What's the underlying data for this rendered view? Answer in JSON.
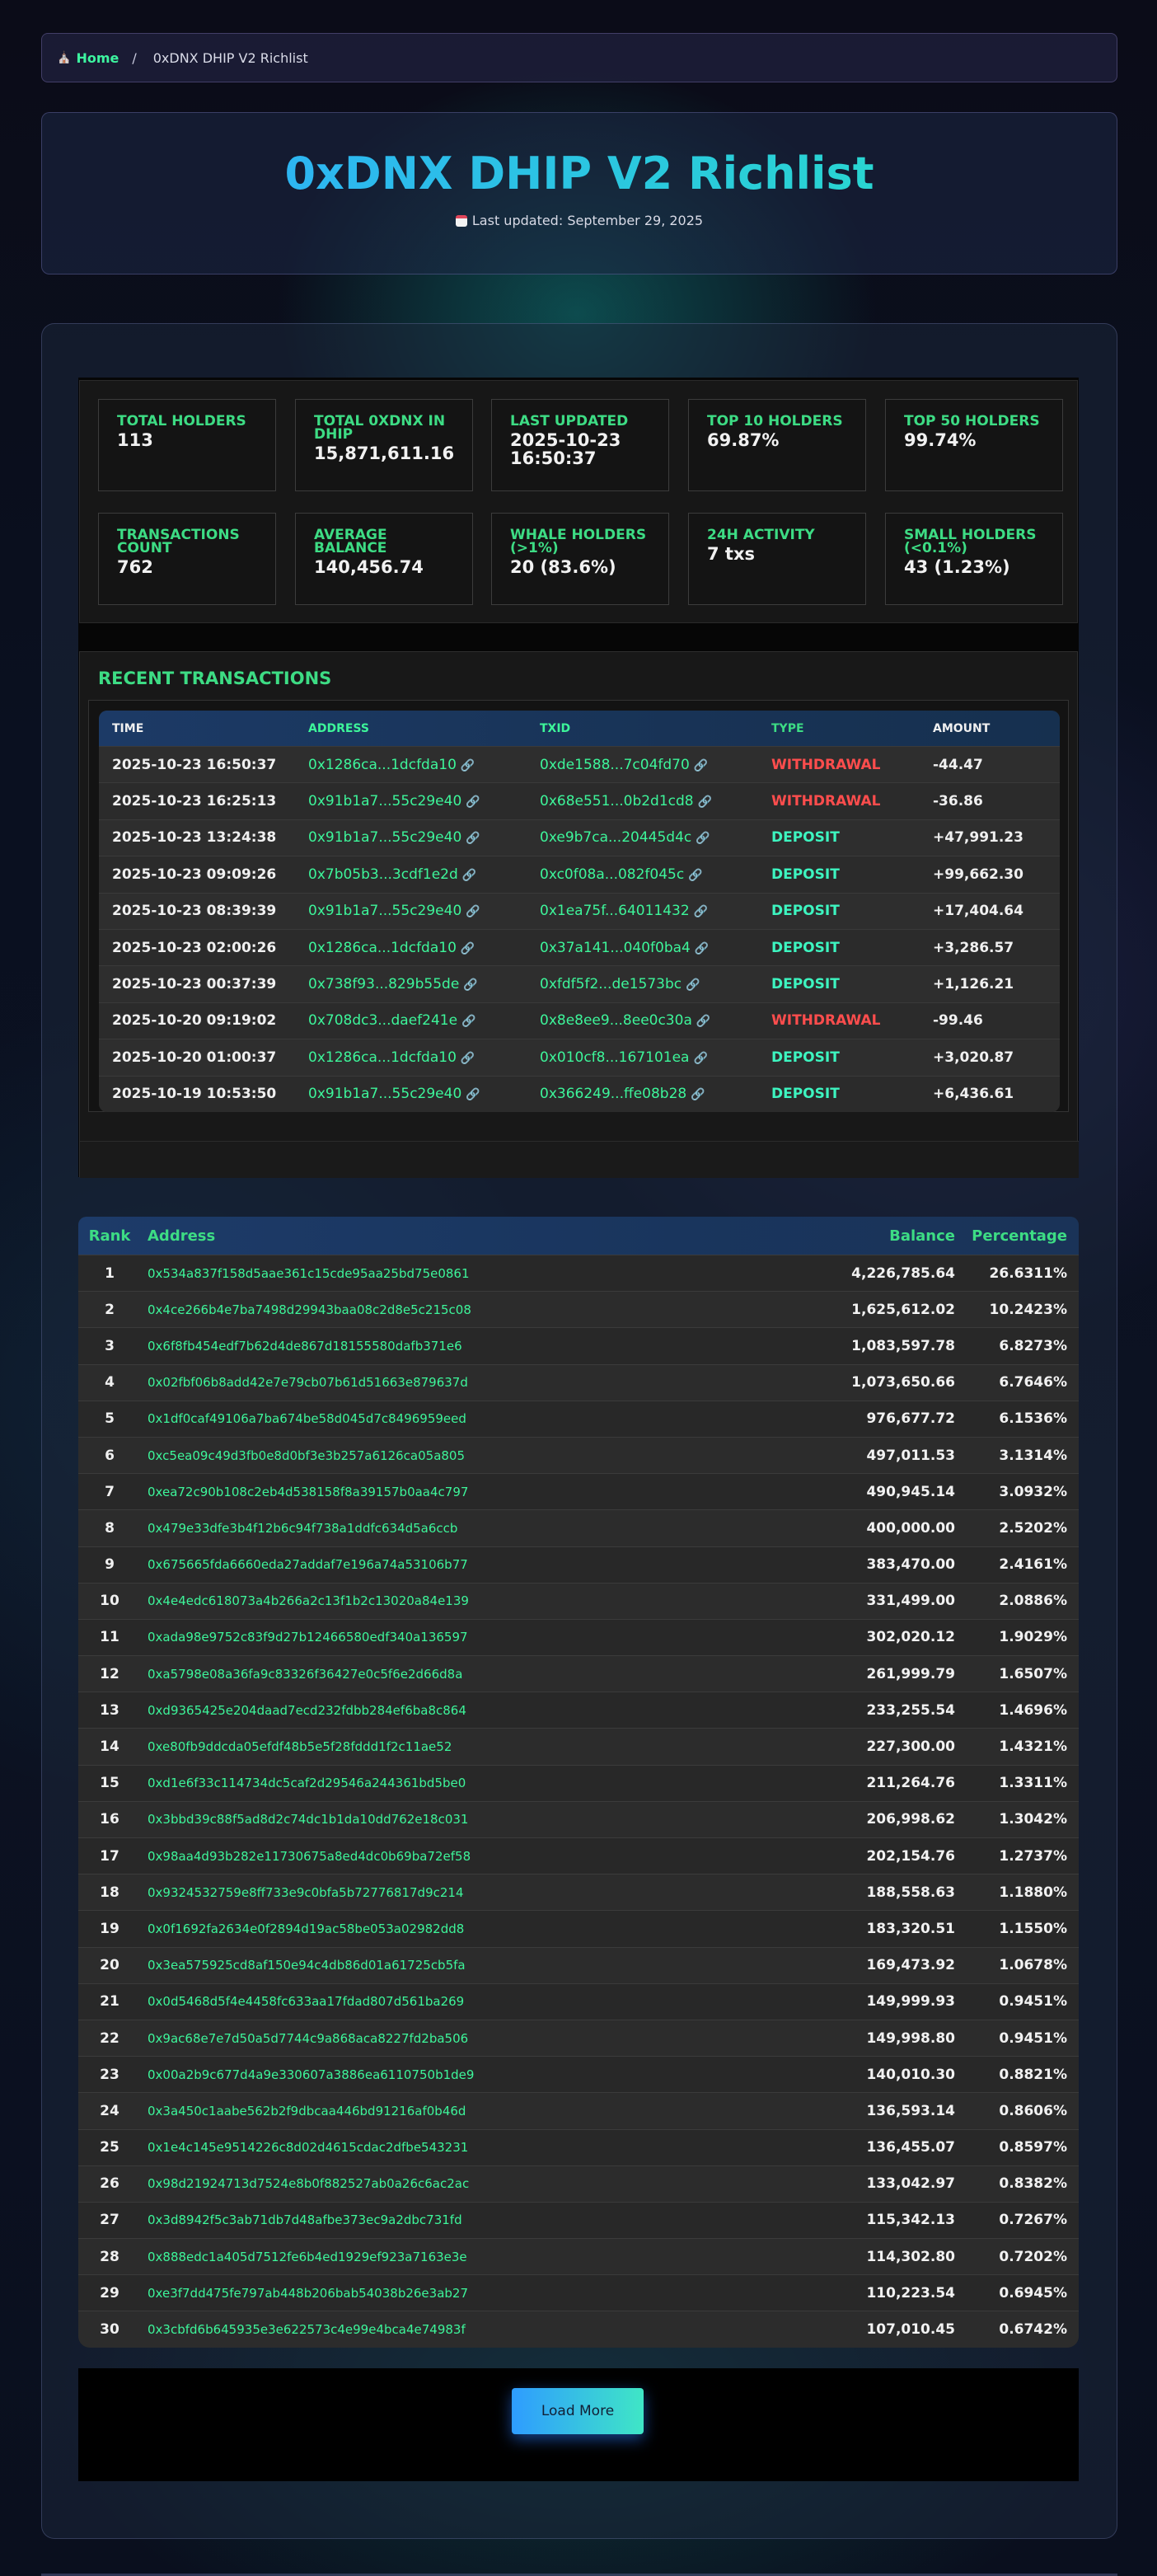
{
  "breadcrumb": {
    "home": "Home",
    "separator": "/",
    "current": "0xDNX DHIP V2 Richlist"
  },
  "header": {
    "title": "0xDNX DHIP V2 Richlist",
    "updated": "Last updated: September 29, 2025"
  },
  "stats": [
    {
      "label": "Total Holders",
      "value": "113"
    },
    {
      "label": "Total 0xDNX in DHIP",
      "value": "15,871,611.16"
    },
    {
      "label": "Last Updated",
      "value": "2025-10-23 16:50:37"
    },
    {
      "label": "Top 10 Holders",
      "value": "69.87%"
    },
    {
      "label": "Top 50 Holders",
      "value": "99.74%"
    },
    {
      "label": "Transactions Count",
      "value": "762"
    },
    {
      "label": "Average Balance",
      "value": "140,456.74"
    },
    {
      "label": "Whale Holders (>1%)",
      "value": "20 (83.6%)"
    },
    {
      "label": "24H Activity",
      "value": "7 txs"
    },
    {
      "label": "Small Holders (<0.1%)",
      "value": "43 (1.23%)"
    }
  ],
  "recent": {
    "title": "RECENT TRANSACTIONS",
    "columns": [
      "TIME",
      "ADDRESS",
      "TXID",
      "TYPE",
      "AMOUNT"
    ],
    "rows": [
      {
        "time": "2025-10-23 16:50:37",
        "address": "0x1286ca...1dcfda10",
        "txid": "0xde1588...7c04fd70",
        "type": "WITHDRAWAL",
        "amount": "-44.47"
      },
      {
        "time": "2025-10-23 16:25:13",
        "address": "0x91b1a7...55c29e40",
        "txid": "0x68e551...0b2d1cd8",
        "type": "WITHDRAWAL",
        "amount": "-36.86"
      },
      {
        "time": "2025-10-23 13:24:38",
        "address": "0x91b1a7...55c29e40",
        "txid": "0xe9b7ca...20445d4c",
        "type": "DEPOSIT",
        "amount": "+47,991.23"
      },
      {
        "time": "2025-10-23 09:09:26",
        "address": "0x7b05b3...3cdf1e2d",
        "txid": "0xc0f08a...082f045c",
        "type": "DEPOSIT",
        "amount": "+99,662.30"
      },
      {
        "time": "2025-10-23 08:39:39",
        "address": "0x91b1a7...55c29e40",
        "txid": "0x1ea75f...64011432",
        "type": "DEPOSIT",
        "amount": "+17,404.64"
      },
      {
        "time": "2025-10-23 02:00:26",
        "address": "0x1286ca...1dcfda10",
        "txid": "0x37a141...040f0ba4",
        "type": "DEPOSIT",
        "amount": "+3,286.57"
      },
      {
        "time": "2025-10-23 00:37:39",
        "address": "0x738f93...829b55de",
        "txid": "0xfdf5f2...de1573bc",
        "type": "DEPOSIT",
        "amount": "+1,126.21"
      },
      {
        "time": "2025-10-20 09:19:02",
        "address": "0x708dc3...daef241e",
        "txid": "0x8e8ee9...8ee0c30a",
        "type": "WITHDRAWAL",
        "amount": "-99.46"
      },
      {
        "time": "2025-10-20 01:00:37",
        "address": "0x1286ca...1dcfda10",
        "txid": "0x010cf8...167101ea",
        "type": "DEPOSIT",
        "amount": "+3,020.87"
      },
      {
        "time": "2025-10-19 10:53:50",
        "address": "0x91b1a7...55c29e40",
        "txid": "0x366249...ffe08b28",
        "type": "DEPOSIT",
        "amount": "+6,436.61"
      }
    ]
  },
  "richlist": {
    "columns": {
      "rank": "Rank",
      "address": "Address",
      "balance": "Balance",
      "percentage": "Percentage"
    },
    "rows": [
      {
        "rank": "1",
        "address": "0x534a837f158d5aae361c15cde95aa25bd75e0861",
        "balance": "4,226,785.64",
        "pct": "26.6311%"
      },
      {
        "rank": "2",
        "address": "0x4ce266b4e7ba7498d29943baa08c2d8e5c215c08",
        "balance": "1,625,612.02",
        "pct": "10.2423%"
      },
      {
        "rank": "3",
        "address": "0x6f8fb454edf7b62d4de867d18155580dafb371e6",
        "balance": "1,083,597.78",
        "pct": "6.8273%"
      },
      {
        "rank": "4",
        "address": "0x02fbf06b8add42e7e79cb07b61d51663e879637d",
        "balance": "1,073,650.66",
        "pct": "6.7646%"
      },
      {
        "rank": "5",
        "address": "0x1df0caf49106a7ba674be58d045d7c8496959eed",
        "balance": "976,677.72",
        "pct": "6.1536%"
      },
      {
        "rank": "6",
        "address": "0xc5ea09c49d3fb0e8d0bf3e3b257a6126ca05a805",
        "balance": "497,011.53",
        "pct": "3.1314%"
      },
      {
        "rank": "7",
        "address": "0xea72c90b108c2eb4d538158f8a39157b0aa4c797",
        "balance": "490,945.14",
        "pct": "3.0932%"
      },
      {
        "rank": "8",
        "address": "0x479e33dfe3b4f12b6c94f738a1ddfc634d5a6ccb",
        "balance": "400,000.00",
        "pct": "2.5202%"
      },
      {
        "rank": "9",
        "address": "0x675665fda6660eda27addaf7e196a74a53106b77",
        "balance": "383,470.00",
        "pct": "2.4161%"
      },
      {
        "rank": "10",
        "address": "0x4e4edc618073a4b266a2c13f1b2c13020a84e139",
        "balance": "331,499.00",
        "pct": "2.0886%"
      },
      {
        "rank": "11",
        "address": "0xada98e9752c83f9d27b12466580edf340a136597",
        "balance": "302,020.12",
        "pct": "1.9029%"
      },
      {
        "rank": "12",
        "address": "0xa5798e08a36fa9c83326f36427e0c5f6e2d66d8a",
        "balance": "261,999.79",
        "pct": "1.6507%"
      },
      {
        "rank": "13",
        "address": "0xd9365425e204daad7ecd232fdbb284ef6ba8c864",
        "balance": "233,255.54",
        "pct": "1.4696%"
      },
      {
        "rank": "14",
        "address": "0xe80fb9ddcda05efdf48b5e5f28fddd1f2c11ae52",
        "balance": "227,300.00",
        "pct": "1.4321%"
      },
      {
        "rank": "15",
        "address": "0xd1e6f33c114734dc5caf2d29546a244361bd5be0",
        "balance": "211,264.76",
        "pct": "1.3311%"
      },
      {
        "rank": "16",
        "address": "0x3bbd39c88f5ad8d2c74dc1b1da10dd762e18c031",
        "balance": "206,998.62",
        "pct": "1.3042%"
      },
      {
        "rank": "17",
        "address": "0x98aa4d93b282e11730675a8ed4dc0b69ba72ef58",
        "balance": "202,154.76",
        "pct": "1.2737%"
      },
      {
        "rank": "18",
        "address": "0x9324532759e8ff733e9c0bfa5b72776817d9c214",
        "balance": "188,558.63",
        "pct": "1.1880%"
      },
      {
        "rank": "19",
        "address": "0x0f1692fa2634e0f2894d19ac58be053a02982dd8",
        "balance": "183,320.51",
        "pct": "1.1550%"
      },
      {
        "rank": "20",
        "address": "0x3ea575925cd8af150e94c4db86d01a61725cb5fa",
        "balance": "169,473.92",
        "pct": "1.0678%"
      },
      {
        "rank": "21",
        "address": "0x0d5468d5f4e4458fc633aa17fdad807d561ba269",
        "balance": "149,999.93",
        "pct": "0.9451%"
      },
      {
        "rank": "22",
        "address": "0x9ac68e7e7d50a5d7744c9a868aca8227fd2ba506",
        "balance": "149,998.80",
        "pct": "0.9451%"
      },
      {
        "rank": "23",
        "address": "0x00a2b9c677d4a9e330607a3886ea6110750b1de9",
        "balance": "140,010.30",
        "pct": "0.8821%"
      },
      {
        "rank": "24",
        "address": "0x3a450c1aabe562b2f9dbcaa446bd91216af0b46d",
        "balance": "136,593.14",
        "pct": "0.8606%"
      },
      {
        "rank": "25",
        "address": "0x1e4c145e9514226c8d02d4615cdac2dfbe543231",
        "balance": "136,455.07",
        "pct": "0.8597%"
      },
      {
        "rank": "26",
        "address": "0x98d21924713d7524e8b0f882527ab0a26c6ac2ac",
        "balance": "133,042.97",
        "pct": "0.8382%"
      },
      {
        "rank": "27",
        "address": "0x3d8942f5c3ab71db7d48afbe373ec9a2dbc731fd",
        "balance": "115,342.13",
        "pct": "0.7267%"
      },
      {
        "rank": "28",
        "address": "0x888edc1a405d7512fe6b4ed1929ef923a7163e3e",
        "balance": "114,302.80",
        "pct": "0.7202%"
      },
      {
        "rank": "29",
        "address": "0xe3f7dd475fe797ab448b206bab54038b26e3ab27",
        "balance": "110,223.54",
        "pct": "0.6945%"
      },
      {
        "rank": "30",
        "address": "0x3cbfd6b645935e3e622573c4e99e4bca4e74983f",
        "balance": "107,010.45",
        "pct": "0.6742%"
      }
    ]
  },
  "load_more": "Load More",
  "colors": {
    "accent_green": "#3ddc84",
    "address_green": "#3df59a",
    "withdrawal_red": "#ff4d4d",
    "deposit_teal": "#3df5c0",
    "title_gradient_start": "#2fa8ff",
    "title_gradient_end": "#27e2c4"
  },
  "icons": {
    "home": "home-icon",
    "calendar": "calendar-icon",
    "link": "link-icon"
  }
}
